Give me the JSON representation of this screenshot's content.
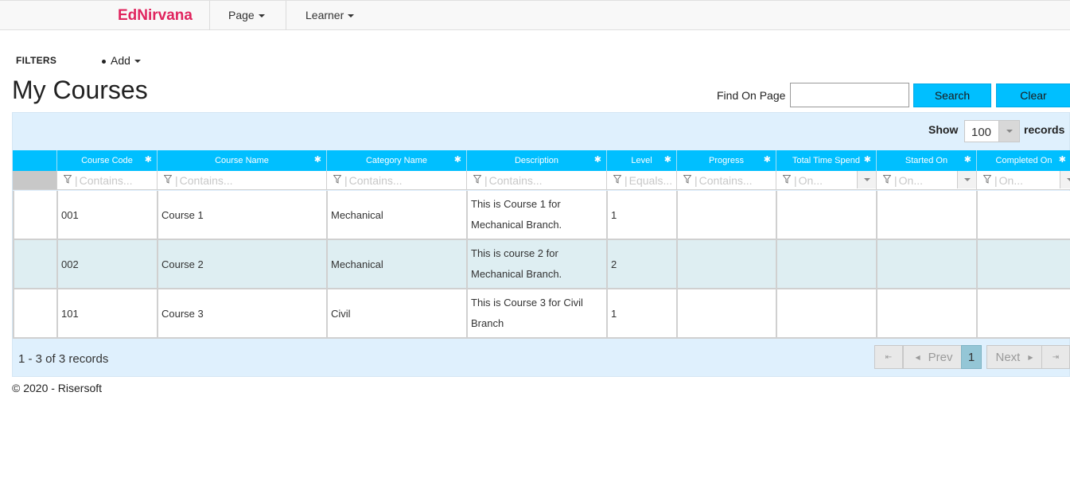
{
  "navbar": {
    "brand": "EdNirvana",
    "menu": [
      {
        "label": "Page"
      },
      {
        "label": "Learner"
      }
    ]
  },
  "filters": {
    "label": "FILTERS",
    "add_label": "Add"
  },
  "page_title": "My Courses",
  "find": {
    "label": "Find On Page",
    "value": "",
    "search_label": "Search",
    "clear_label": "Clear"
  },
  "pager_top": {
    "show_label": "Show",
    "page_size": "100",
    "records_label": "records"
  },
  "grid": {
    "columns": [
      {
        "header": "Course Code",
        "filter": "Contains..."
      },
      {
        "header": "Course Name",
        "filter": "Contains..."
      },
      {
        "header": "Category Name",
        "filter": "Contains..."
      },
      {
        "header": "Description",
        "filter": "Contains..."
      },
      {
        "header": "Level",
        "filter": "Equals..."
      },
      {
        "header": "Progress",
        "filter": "Contains..."
      },
      {
        "header": "Total Time Spend",
        "filter": "On..."
      },
      {
        "header": "Started On",
        "filter": "On..."
      },
      {
        "header": "Completed On",
        "filter": "On..."
      }
    ],
    "rows": [
      {
        "code": "001",
        "name": "Course 1",
        "category": "Mechanical",
        "description": "This is Course 1 for Mechanical Branch.",
        "level": "1",
        "progress": "",
        "time": "",
        "started": "",
        "completed": ""
      },
      {
        "code": "002",
        "name": "Course 2",
        "category": "Mechanical",
        "description": "This is course 2 for Mechanical Branch.",
        "level": "2",
        "progress": "",
        "time": "",
        "started": "",
        "completed": ""
      },
      {
        "code": "101",
        "name": "Course 3",
        "category": "Civil",
        "description": "This is Course 3 for Civil Branch",
        "level": "1",
        "progress": "",
        "time": "",
        "started": "",
        "completed": ""
      }
    ]
  },
  "pager_bottom": {
    "summary": "1 - 3 of 3 records",
    "first_icon": "first-page-icon",
    "prev_label": "Prev",
    "current_page": "1",
    "next_label": "Next",
    "last_icon": "last-page-icon"
  },
  "footer": {
    "copyright": "© 2020 - Risersoft"
  },
  "colors": {
    "brand": "#e0245e",
    "accent": "#00bfff",
    "grid_bg": "#dff0fd",
    "alt_row": "#deeef2"
  }
}
